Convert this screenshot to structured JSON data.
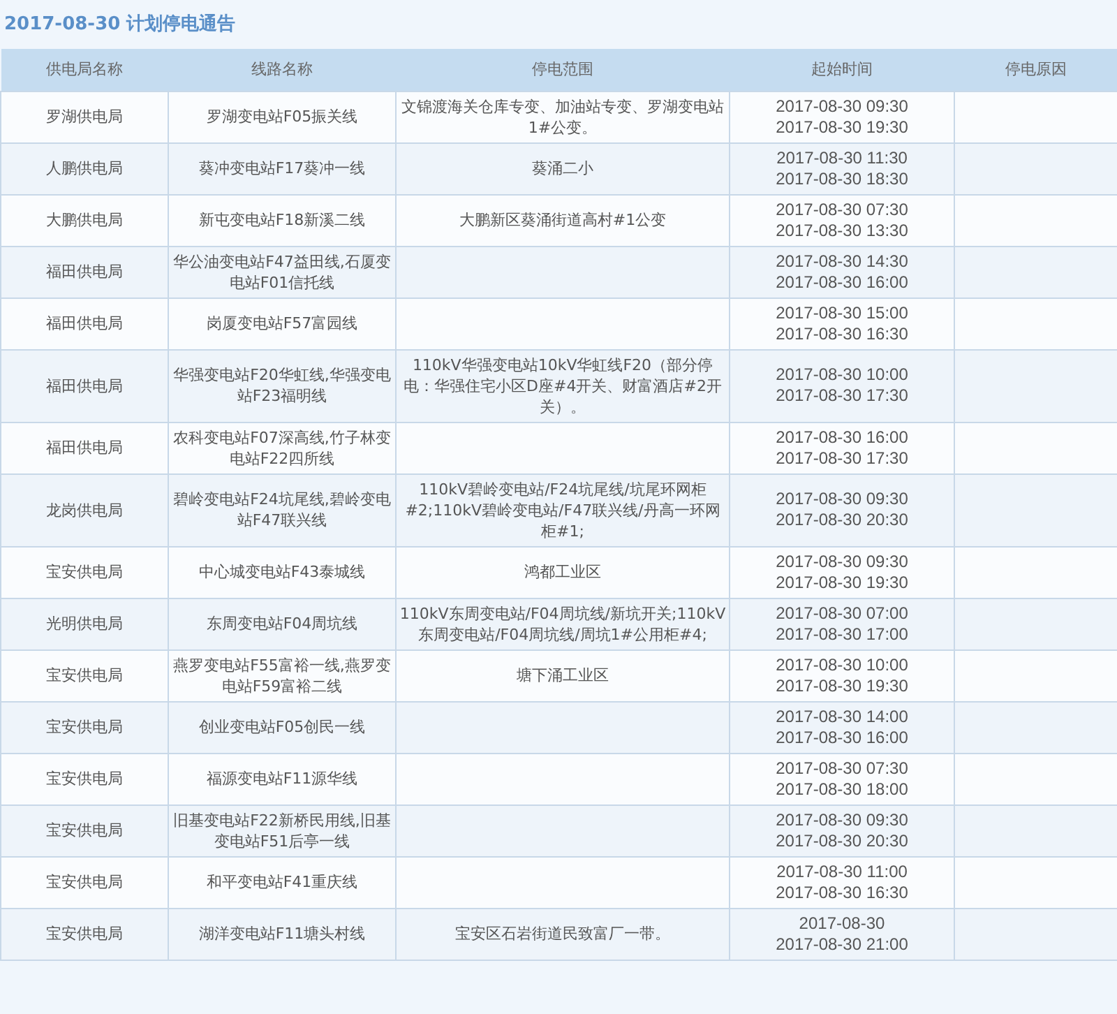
{
  "title": "2017-08-30 计划停电通告",
  "columns": [
    "供电局名称",
    "线路名称",
    "停电范围",
    "起始时间",
    "停电原因"
  ],
  "rows": [
    {
      "office": "罗湖供电局",
      "line": "罗湖变电站F05振关线",
      "range": "文锦渡海关仓库专变、加油站专变、罗湖变电站1#公变。",
      "times": [
        "2017-08-30 09:30",
        "2017-08-30 19:30"
      ]
    },
    {
      "office": "人鹏供电局",
      "line": "葵冲变电站F17葵冲一线",
      "range": "葵涌二小",
      "times": [
        "2017-08-30 11:30",
        "2017-08-30 18:30"
      ]
    },
    {
      "office": "大鹏供电局",
      "line": "新屯变电站F18新溪二线",
      "range": "大鹏新区葵涌街道高村#1公变",
      "times": [
        "2017-08-30 07:30",
        "2017-08-30 13:30"
      ]
    },
    {
      "office": "福田供电局",
      "line": "华公油变电站F47益田线,石厦变电站F01信托线",
      "times": [
        "2017-08-30 14:30",
        "2017-08-30 16:00"
      ]
    },
    {
      "office": "福田供电局",
      "line": "岗厦变电站F57富园线",
      "times": [
        "2017-08-30 15:00",
        "2017-08-30 16:30"
      ]
    },
    {
      "office": "福田供电局",
      "line": "华强变电站F20华虹线,华强变电站F23福明线",
      "range": "110kV华强变电站10kV华虹线F20（部分停电：华强住宅小区D座#4开关、财富酒店#2开关）。",
      "times": [
        "2017-08-30 10:00",
        "2017-08-30 17:30"
      ]
    },
    {
      "office": "福田供电局",
      "line": "农科变电站F07深高线,竹子林变电站F22四所线",
      "times": [
        "2017-08-30 16:00",
        "2017-08-30 17:30"
      ]
    },
    {
      "office": "龙岗供电局",
      "line": "碧岭变电站F24坑尾线,碧岭变电站F47联兴线",
      "range": "110kV碧岭变电站/F24坑尾线/坑尾环网柜#2;110kV碧岭变电站/F47联兴线/丹高一环网柜#1;",
      "times": [
        "2017-08-30 09:30",
        "2017-08-30 20:30"
      ]
    },
    {
      "office": "宝安供电局",
      "line": "中心城变电站F43泰城线",
      "range": "鸿都工业区",
      "times": [
        "2017-08-30 09:30",
        "2017-08-30 19:30"
      ]
    },
    {
      "office": "光明供电局",
      "line": "东周变电站F04周坑线",
      "range": "110kV东周变电站/F04周坑线/新坑开关;110kV东周变电站/F04周坑线/周坑1#公用柜#4;",
      "times": [
        "2017-08-30 07:00",
        "2017-08-30 17:00"
      ]
    },
    {
      "office": "宝安供电局",
      "line": "燕罗变电站F55富裕一线,燕罗变电站F59富裕二线",
      "range": "塘下涌工业区",
      "times": [
        "2017-08-30 10:00",
        "2017-08-30 19:30"
      ]
    },
    {
      "office": "宝安供电局",
      "line": "创业变电站F05创民一线",
      "times": [
        "2017-08-30 14:00",
        "2017-08-30 16:00"
      ]
    },
    {
      "office": "宝安供电局",
      "line": "福源变电站F11源华线",
      "times": [
        "2017-08-30 07:30",
        "2017-08-30 18:00"
      ]
    },
    {
      "office": "宝安供电局",
      "line": "旧基变电站F22新桥民用线,旧基变电站F51后亭一线",
      "times": [
        "2017-08-30 09:30",
        "2017-08-30 20:30"
      ]
    },
    {
      "office": "宝安供电局",
      "line": "和平变电站F41重庆线",
      "times": [
        "2017-08-30 11:00",
        "2017-08-30 16:30"
      ]
    },
    {
      "office": "宝安供电局",
      "line": "湖洋变电站F11塘头村线",
      "range": "宝安区石岩街道民致富厂一带。",
      "times": [
        "2017-08-30",
        "2017-08-30 21:00"
      ]
    }
  ]
}
